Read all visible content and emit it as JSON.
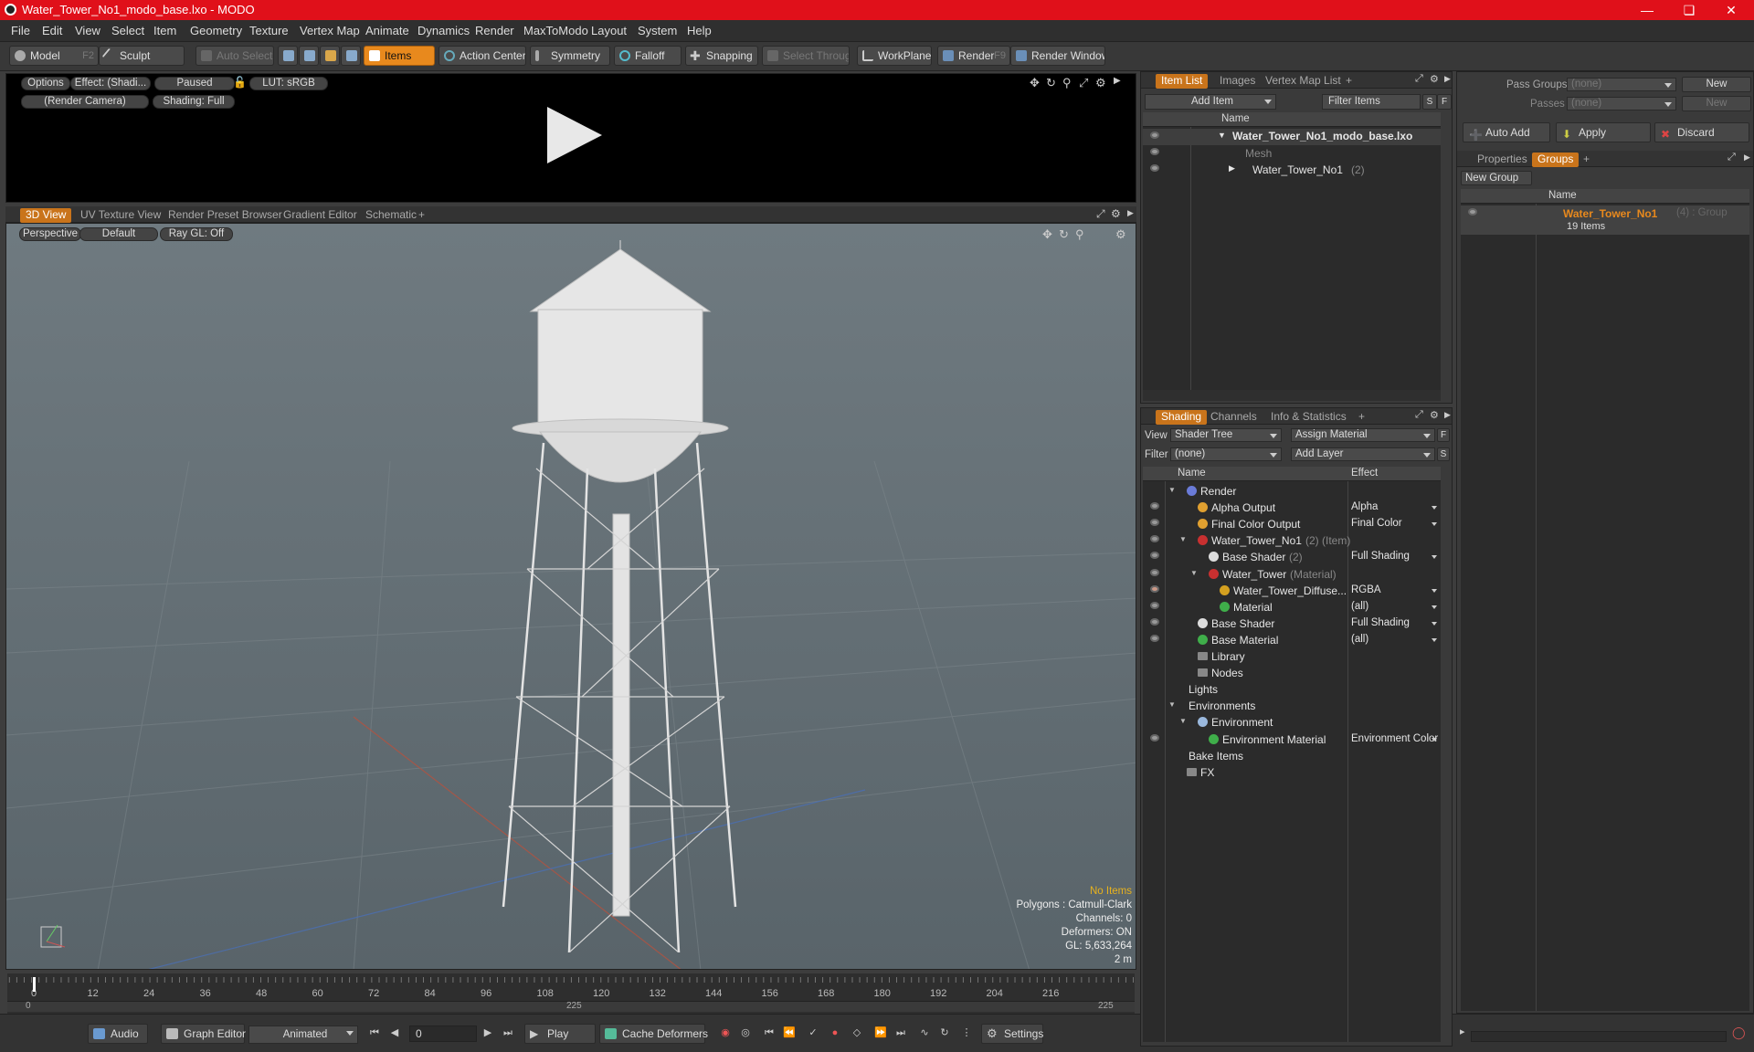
{
  "window": {
    "title": "Water_Tower_No1_modo_base.lxo - MODO"
  },
  "menu": [
    "File",
    "Edit",
    "View",
    "Select",
    "Item",
    "Geometry",
    "Texture",
    "Vertex Map",
    "Animate",
    "Dynamics",
    "Render",
    "MaxToModo",
    "Layout",
    "System",
    "Help"
  ],
  "toolbar": {
    "model": "Model",
    "model_key": "F2",
    "sculpt": "Sculpt",
    "auto_select": "Auto Select",
    "items": "Items",
    "action_center": "Action Center",
    "symmetry": "Symmetry",
    "falloff": "Falloff",
    "snapping": "Snapping",
    "select_through": "Select Through",
    "workplane": "WorkPlane",
    "render": "Render",
    "render_key": "F9",
    "render_window": "Render Window"
  },
  "preview": {
    "options": "Options",
    "effect": "Effect: (Shadi...",
    "paused": "Paused",
    "lut": "LUT: sRGB",
    "camera": "(Render Camera)",
    "shading": "Shading: Full"
  },
  "viewport_tabs": [
    "3D View",
    "UV Texture View",
    "Render Preset Browser",
    "Gradient Editor",
    "Schematic",
    "+"
  ],
  "viewport": {
    "perspective": "Perspective",
    "default": "Default",
    "raygl": "Ray GL: Off",
    "info": {
      "items": "No Items",
      "polygons": "Polygons : Catmull-Clark",
      "channels": "Channels: 0",
      "deformers": "Deformers: ON",
      "gl": "GL: 5,633,264",
      "scale": "2 m"
    }
  },
  "timeline": {
    "ticks": [
      "0",
      "12",
      "24",
      "36",
      "48",
      "60",
      "72",
      "84",
      "96",
      "108",
      "120",
      "132",
      "144",
      "156",
      "168",
      "180",
      "192",
      "204",
      "216"
    ],
    "start": "0",
    "mid": "225",
    "end": "225"
  },
  "bottom": {
    "audio": "Audio",
    "graph_editor": "Graph Editor",
    "animated": "Animated",
    "frame": "0",
    "play": "Play",
    "cache_deformers": "Cache Deformers",
    "settings": "Settings"
  },
  "itemlist": {
    "tabs": [
      "Item List",
      "Images",
      "Vertex Map List",
      "+"
    ],
    "add_item": "Add Item",
    "filter_items": "Filter Items",
    "col_name": "Name",
    "rows": [
      {
        "name": "Water_Tower_No1_modo_base.lxo",
        "count": ""
      },
      {
        "name": "Mesh",
        "count": ""
      },
      {
        "name": "Water_Tower_No1",
        "count": "(2)"
      }
    ]
  },
  "shading": {
    "tabs": [
      "Shading",
      "Channels",
      "Info & Statistics",
      "+"
    ],
    "view_label": "View",
    "view_value": "Shader Tree",
    "assign_material": "Assign Material",
    "filter_label": "Filter",
    "filter_value": "(none)",
    "add_layer": "Add Layer",
    "col_name": "Name",
    "col_effect": "Effect",
    "rows": [
      {
        "name": "Render",
        "suffix": "",
        "effect": ""
      },
      {
        "name": "Alpha Output",
        "suffix": "",
        "effect": "Alpha"
      },
      {
        "name": "Final Color Output",
        "suffix": "",
        "effect": "Final Color"
      },
      {
        "name": "Water_Tower_No1",
        "suffix": "(2) (Item)",
        "effect": ""
      },
      {
        "name": "Base Shader",
        "suffix": "(2)",
        "effect": "Full Shading"
      },
      {
        "name": "Water_Tower",
        "suffix": "(Material)",
        "effect": ""
      },
      {
        "name": "Water_Tower_Diffuse...",
        "suffix": "",
        "effect": "RGBA"
      },
      {
        "name": "Material",
        "suffix": "",
        "effect": "(all)"
      },
      {
        "name": "Base Shader",
        "suffix": "",
        "effect": "Full Shading"
      },
      {
        "name": "Base Material",
        "suffix": "",
        "effect": "(all)"
      },
      {
        "name": "Library",
        "suffix": "",
        "effect": ""
      },
      {
        "name": "Nodes",
        "suffix": "",
        "effect": ""
      },
      {
        "name": "Lights",
        "suffix": "",
        "effect": ""
      },
      {
        "name": "Environments",
        "suffix": "",
        "effect": ""
      },
      {
        "name": "Environment",
        "suffix": "",
        "effect": ""
      },
      {
        "name": "Environment Material",
        "suffix": "",
        "effect": "Environment Color"
      },
      {
        "name": "Bake Items",
        "suffix": "",
        "effect": ""
      },
      {
        "name": "FX",
        "suffix": "",
        "effect": ""
      }
    ]
  },
  "groups": {
    "pass_groups": "Pass Groups",
    "pass_groups_value": "(none)",
    "new": "New",
    "passes": "Passes",
    "passes_value": "(none)",
    "new2": "New",
    "auto_add": "Auto Add",
    "apply": "Apply",
    "discard": "Discard",
    "tabs": [
      "Properties",
      "Groups",
      "+"
    ],
    "new_group": "New Group",
    "col_name": "Name",
    "group_name": "Water_Tower_No1",
    "group_suffix": "(4) : Group",
    "group_items": "19 Items"
  },
  "colors": {
    "accent": "#e8891d",
    "titlebar": "#e0101a"
  }
}
